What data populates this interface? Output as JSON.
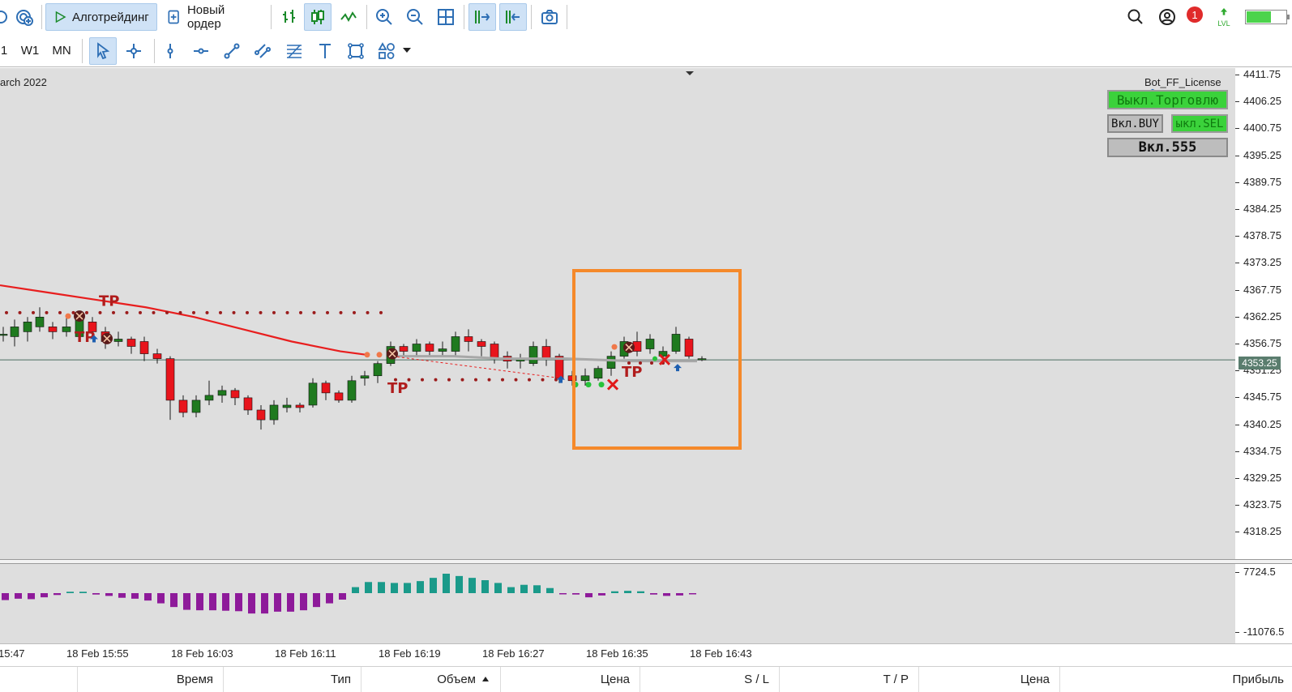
{
  "toolbar": {
    "algotrading_label": "Алготрейдинг",
    "new_order_label": "Новый ордер",
    "notifications_count": "1",
    "lvl_label": "LVL",
    "battery_level": 0.6
  },
  "timeframes": [
    "1",
    "W1",
    "MN"
  ],
  "chart": {
    "period_label": "arch 2022",
    "expert_name": "Bot_FF_License",
    "buttons": {
      "trading_off": "Выкл.Торговлю",
      "buy_on": "Вкл.BUY",
      "sell_off": "ыкл.SEL",
      "magic_on": "Вкл.555"
    },
    "current_price": "4353.25",
    "price_scale": [
      "4411.75",
      "4406.25",
      "4400.75",
      "4395.25",
      "4389.75",
      "4384.25",
      "4378.75",
      "4373.25",
      "4367.75",
      "4362.25",
      "4356.75",
      "4351.25",
      "4345.75",
      "4340.25",
      "4334.75",
      "4329.25",
      "4323.75",
      "4318.25"
    ],
    "time_scale": [
      "15:47",
      "18 Feb 15:55",
      "18 Feb 16:03",
      "18 Feb 16:11",
      "18 Feb 16:19",
      "18 Feb 16:27",
      "18 Feb 16:35",
      "18 Feb 16:43"
    ],
    "tp_label": "TP",
    "highlight_color": "#f5892a",
    "bull_color": "#1f7a1f",
    "bear_color": "#e8141c",
    "ma_color": "#e81e1e"
  },
  "indicator": {
    "scale_top": "7724.5",
    "scale_bottom": "-11076.5",
    "positive_color": "#1a9a8a",
    "negative_color": "#8e1a9a"
  },
  "trade_table": {
    "columns": [
      "Время",
      "Тип",
      "Объем",
      "Цена",
      "S / L",
      "T / P",
      "Цена",
      "Прибыль"
    ]
  }
}
